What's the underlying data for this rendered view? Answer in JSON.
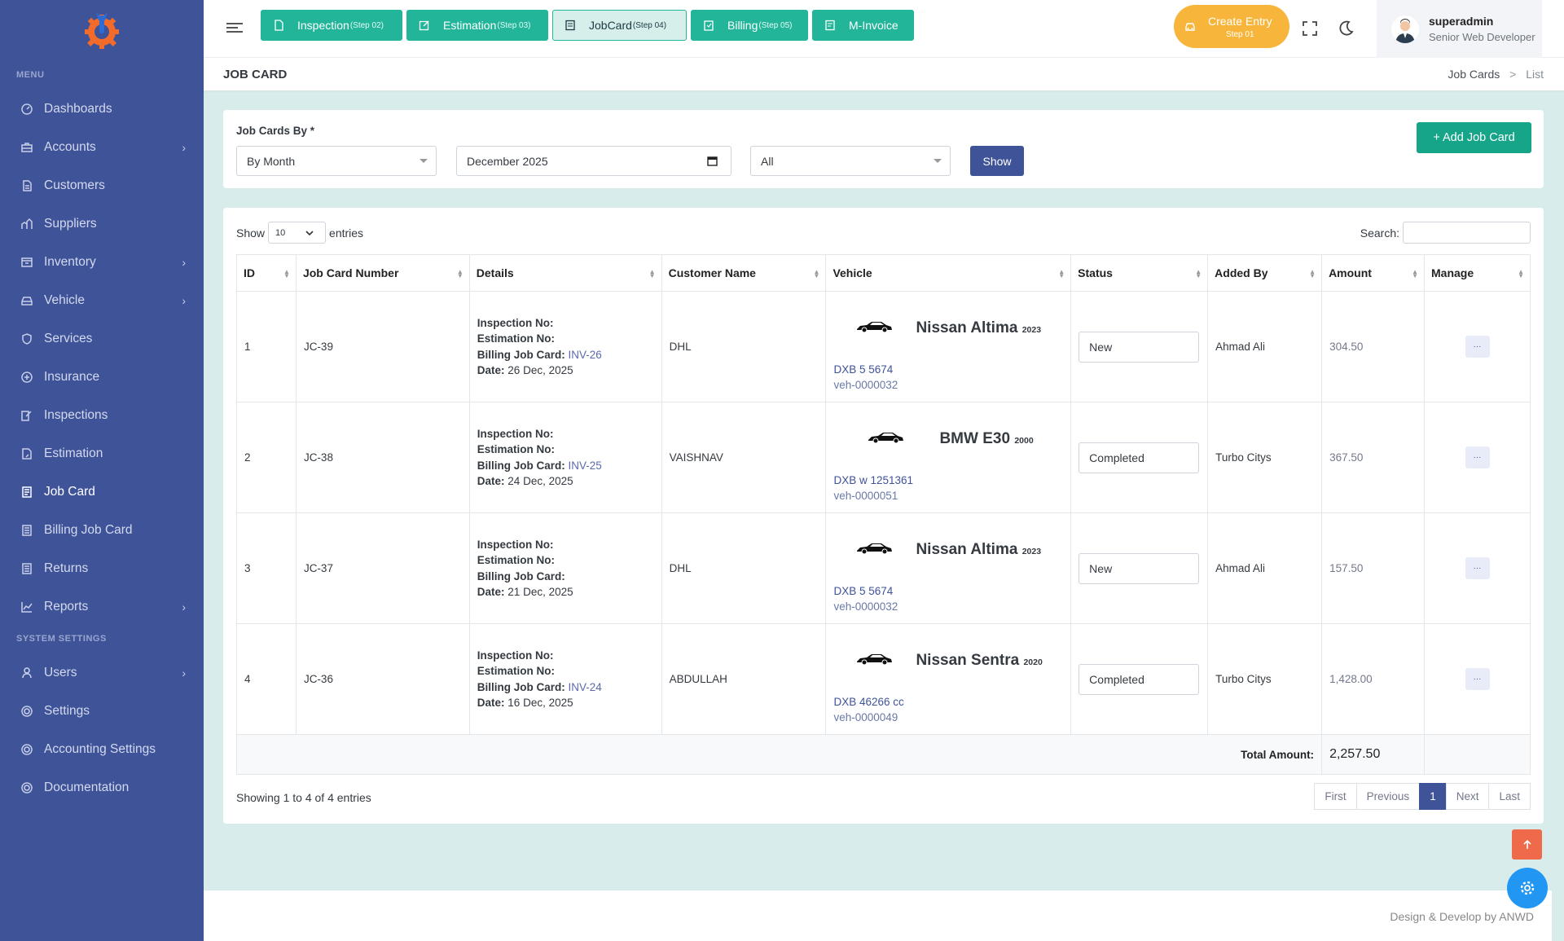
{
  "sidebar": {
    "menu_title": "MENU",
    "system_title": "SYSTEM SETTINGS",
    "items": [
      {
        "label": "Dashboards",
        "icon": "dashboard-icon",
        "chevron": false
      },
      {
        "label": "Accounts",
        "icon": "briefcase-icon",
        "chevron": true
      },
      {
        "label": "Customers",
        "icon": "file-icon",
        "chevron": false
      },
      {
        "label": "Suppliers",
        "icon": "supplier-icon",
        "chevron": false
      },
      {
        "label": "Inventory",
        "icon": "inventory-icon",
        "chevron": true
      },
      {
        "label": "Vehicle",
        "icon": "car-icon",
        "chevron": true
      },
      {
        "label": "Services",
        "icon": "services-icon",
        "chevron": false
      },
      {
        "label": "Insurance",
        "icon": "insurance-icon",
        "chevron": false
      },
      {
        "label": "Inspections",
        "icon": "edit-icon",
        "chevron": false
      },
      {
        "label": "Estimation",
        "icon": "estimation-icon",
        "chevron": false
      },
      {
        "label": "Job Card",
        "icon": "document-icon",
        "chevron": false
      },
      {
        "label": "Billing Job Card",
        "icon": "billing-icon",
        "chevron": false
      },
      {
        "label": "Returns",
        "icon": "returns-icon",
        "chevron": false
      },
      {
        "label": "Reports",
        "icon": "chart-icon",
        "chevron": true
      }
    ],
    "system_items": [
      {
        "label": "Users",
        "icon": "user-icon",
        "chevron": true
      },
      {
        "label": "Settings",
        "icon": "settings-icon",
        "chevron": false
      },
      {
        "label": "Accounting Settings",
        "icon": "accounting-settings-icon",
        "chevron": false
      },
      {
        "label": "Documentation",
        "icon": "documentation-icon",
        "chevron": false
      }
    ]
  },
  "steps": [
    {
      "label": "Inspection",
      "sub": "(Step 02)"
    },
    {
      "label": "Estimation",
      "sub": "(Step 03)"
    },
    {
      "label": "JobCard",
      "sub": "(Step 04)"
    },
    {
      "label": "Billing",
      "sub": "(Step 05)"
    },
    {
      "label": "M-Invoice",
      "sub": ""
    }
  ],
  "create_entry": {
    "label": "Create Entry",
    "sub": "Step 01"
  },
  "user": {
    "name": "superadmin",
    "role": "Senior Web Developer"
  },
  "page": {
    "title": "JOB CARD",
    "crumb1": "Job Cards",
    "crumb_sep": ">",
    "crumb2": "List"
  },
  "filters": {
    "label": "Job Cards By *",
    "by": "By Month",
    "date": "December 2025",
    "status": "All",
    "show": "Show",
    "add": "+  Add Job Card"
  },
  "table": {
    "show_label": "Show",
    "entries_label": "entries",
    "page_size": "10",
    "search_label": "Search:",
    "columns": [
      "ID",
      "Job Card Number",
      "Details",
      "Customer Name",
      "Vehicle",
      "Status",
      "Added By",
      "Amount",
      "Manage"
    ],
    "detail_labels": {
      "inspection": "Inspection No:",
      "estimation": "Estimation No:",
      "billing": "Billing Job Card:",
      "date": "Date:"
    },
    "rows": [
      {
        "id": "1",
        "jc": "JC-39",
        "billing": "INV-26",
        "date": "26 Dec, 2025",
        "customer": "DHL",
        "vehicle": "Nissan Altima",
        "year": "2023",
        "plate": "DXB 5 5674",
        "vid": "veh-0000032",
        "status": "New",
        "added_by": "Ahmad Ali",
        "amount": "304.50"
      },
      {
        "id": "2",
        "jc": "JC-38",
        "billing": "INV-25",
        "date": "24 Dec, 2025",
        "customer": "VAISHNAV",
        "vehicle": "BMW E30",
        "year": "2000",
        "plate": "DXB w 1251361",
        "vid": "veh-0000051",
        "status": "Completed",
        "added_by": "Turbo Citys",
        "amount": "367.50"
      },
      {
        "id": "3",
        "jc": "JC-37",
        "billing": "",
        "date": "21 Dec, 2025",
        "customer": "DHL",
        "vehicle": "Nissan Altima",
        "year": "2023",
        "plate": "DXB 5 5674",
        "vid": "veh-0000032",
        "status": "New",
        "added_by": "Ahmad Ali",
        "amount": "157.50"
      },
      {
        "id": "4",
        "jc": "JC-36",
        "billing": "INV-24",
        "date": "16 Dec, 2025",
        "customer": "ABDULLAH",
        "vehicle": "Nissan Sentra",
        "year": "2020",
        "plate": "DXB 46266 cc",
        "vid": "veh-0000049",
        "status": "Completed",
        "added_by": "Turbo Citys",
        "amount": "1,428.00"
      }
    ],
    "manage_label": "···",
    "total_label": "Total Amount:",
    "total_value": "2,257.50",
    "info": "Showing 1 to 4 of 4 entries",
    "pager": [
      "First",
      "Previous",
      "1",
      "Next",
      "Last"
    ]
  },
  "footer": "Design & Develop by ANWD",
  "colors": {
    "sidebar": "#3f5399",
    "step": "#22b59a",
    "accent": "#f7b53b",
    "primary": "#3f5399",
    "success": "#17a589"
  }
}
